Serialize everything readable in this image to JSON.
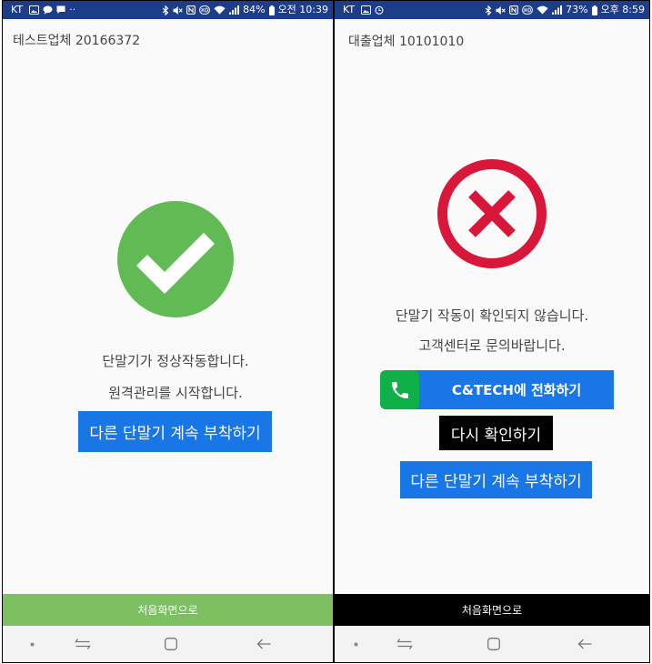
{
  "colors": {
    "status_bar": "#1d3d8a",
    "background": "#fafafa",
    "text": "#444444",
    "primary_button": "#1976e6",
    "retry_button": "#000000",
    "nav_bar": "#f3f3f3"
  },
  "screens": {
    "left": {
      "status_bar": {
        "carrier": "KT",
        "notification_icons": [
          "gallery-icon",
          "chat-icon",
          "message-icon"
        ],
        "more_notifications": "··",
        "system_icons": [
          "bluetooth-icon",
          "mute-icon",
          "nfc-icon",
          "hd-voice-icon",
          "wifi-icon",
          "signal-icon",
          "battery-icon"
        ],
        "battery_level": "84%",
        "time": "오전 10:39"
      },
      "company": "테스트업체 20166372",
      "result": {
        "icon": "check-circle-icon",
        "color": "#62ba54"
      },
      "messages": [
        "단말기가 정상작동합니다.",
        "원격관리를 시작합니다."
      ],
      "attach_button": {
        "label": "다른 단말기 계속 부착하기"
      },
      "footer": {
        "label": "처음화면으로",
        "color": "#7cc062"
      },
      "nav_bar": {
        "icons": [
          "nav-dot-icon",
          "recent-apps-icon",
          "home-icon",
          "back-icon"
        ]
      }
    },
    "right": {
      "status_bar": {
        "carrier": "KT",
        "notification_icons": [
          "gallery-icon",
          "alarm-icon"
        ],
        "system_icons": [
          "bluetooth-icon",
          "mute-icon",
          "nfc-icon",
          "hd-voice-icon",
          "wifi-icon",
          "signal-icon",
          "battery-icon"
        ],
        "battery_level": "73%",
        "time": "오후 8:59"
      },
      "company": "대출업체 10101010",
      "result": {
        "icon": "x-circle-icon",
        "color": "#d9173a"
      },
      "messages": [
        "단말기 작동이 확인되지 않습니다.",
        "고객센터로 문의바랍니다."
      ],
      "call_button": {
        "label": "C&TECH에 전화하기",
        "icon": "phone-icon",
        "icon_color": "#10b048"
      },
      "retry_button": {
        "label": "다시 확인하기"
      },
      "attach_button": {
        "label": "다른 단말기 계속 부착하기"
      },
      "footer": {
        "label": "처음화면으로",
        "color": "#000000"
      },
      "nav_bar": {
        "icons": [
          "nav-dot-icon",
          "recent-apps-icon",
          "home-icon",
          "back-icon"
        ]
      }
    }
  }
}
